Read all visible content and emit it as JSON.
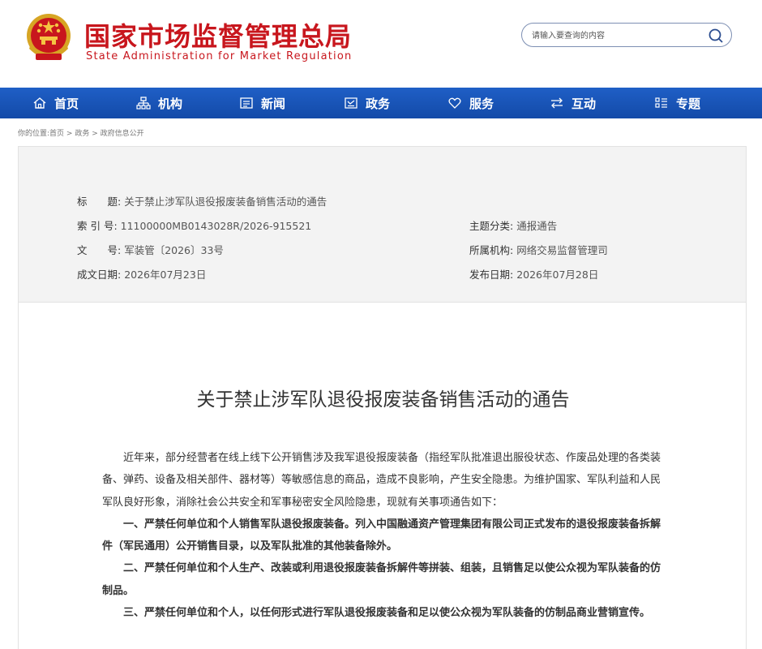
{
  "header": {
    "title": "国家市场监督管理总局",
    "subtitle": "State Administration for Market Regulation",
    "emblem_icon": "national-emblem-icon"
  },
  "search": {
    "placeholder": "请输入要查询的内容",
    "button_icon": "search-icon"
  },
  "nav": {
    "items": [
      {
        "label": "首页",
        "icon": "home-icon"
      },
      {
        "label": "机构",
        "icon": "org-chart-icon"
      },
      {
        "label": "新闻",
        "icon": "news-icon"
      },
      {
        "label": "政务",
        "icon": "document-icon"
      },
      {
        "label": "服务",
        "icon": "heart-icon"
      },
      {
        "label": "互动",
        "icon": "exchange-icon"
      },
      {
        "label": "专题",
        "icon": "list-icon"
      }
    ],
    "background": "#1a56bb"
  },
  "breadcrumb": {
    "prefix": "你的位置:",
    "items": [
      "首页",
      "政务",
      "政府信息公开"
    ],
    "separator": " > "
  },
  "info": {
    "title_label": "标　　题:",
    "title_value": "关于禁止涉军队退役报废装备销售活动的通告",
    "index_label": "索 引 号:",
    "index_value": "11100000MB0143028R/2026-915521",
    "topic_label": "主题分类:",
    "topic_value": "通报通告",
    "doc_label": "文　　号:",
    "doc_value": "军装管〔2026〕33号",
    "org_label": "所属机构:",
    "org_value": "网络交易监督管理司",
    "date_label": "成文日期:",
    "date_value": "2026年07月23日",
    "publish_label": "发布日期:",
    "publish_value": "2026年07月28日"
  },
  "article": {
    "title": "关于禁止涉军队退役报废装备销售活动的通告",
    "paragraphs": [
      {
        "text": "近年来，部分经营者在线上线下公开销售涉及我军退役报废装备（指经军队批准退出服役状态、作废品处理的各类装备、弹药、设备及相关部件、器材等）等敏感信息的商品，造成不良影响，产生安全隐患。为维护国家、军队利益和人民军队良好形象，消除社会公共安全和军事秘密安全风险隐患，现就有关事项通告如下：",
        "bold": false
      },
      {
        "text": "一、严禁任何单位和个人销售军队退役报废装备。列入中国融通资产管理集团有限公司正式发布的退役报废装备拆解件（军民通用）公开销售目录，以及军队批准的其他装备除外。",
        "bold": true
      },
      {
        "text": "二、严禁任何单位和个人生产、改装或利用退役报废装备拆解件等拼装、组装，且销售足以使公众视为军队装备的仿制品。",
        "bold": true
      },
      {
        "text": "三、严禁任何单位和个人，以任何形式进行军队退役报废装备和足以使公众视为军队装备的仿制品商业营销宣传。",
        "bold": true
      }
    ]
  },
  "colors": {
    "brand_red": "#c8161d",
    "nav_blue": "#1a56bb",
    "panel_bg": "#f3f3f3"
  }
}
